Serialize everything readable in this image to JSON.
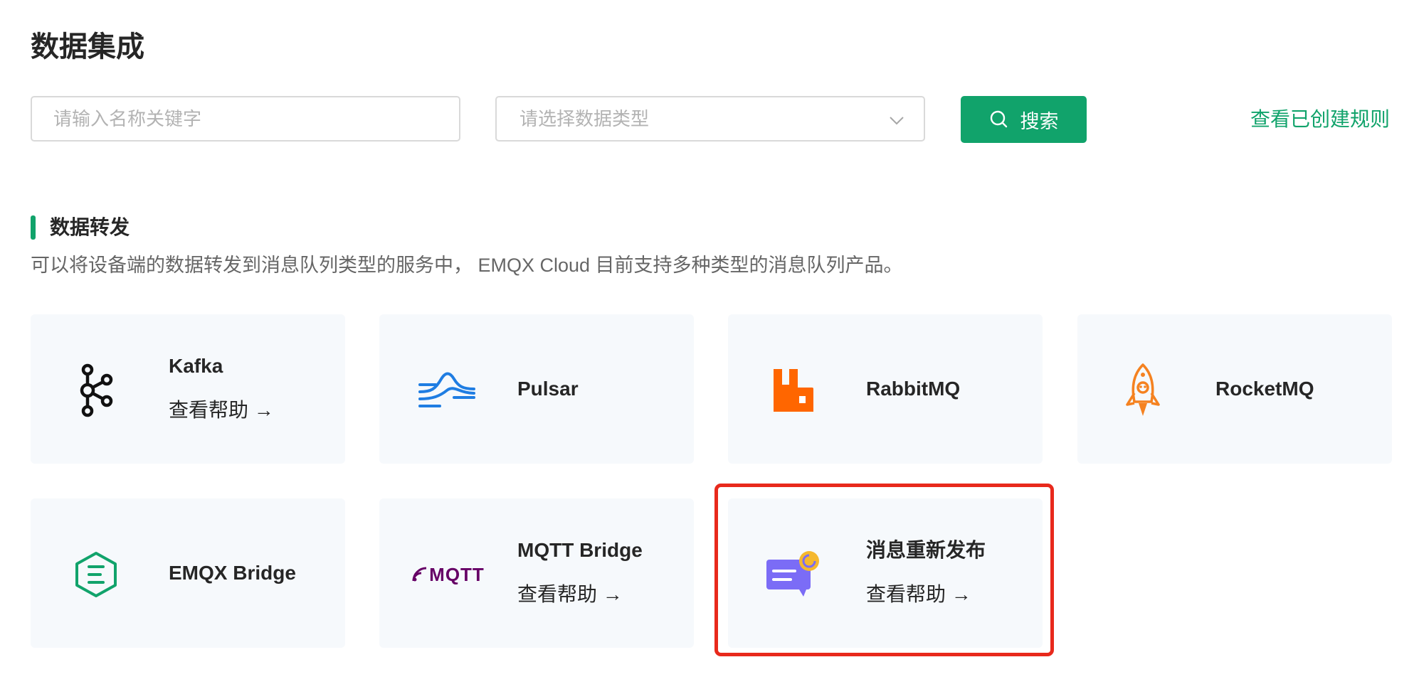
{
  "page": {
    "title": "数据集成"
  },
  "filters": {
    "search_placeholder": "请输入名称关键字",
    "type_select_placeholder": "请选择数据类型",
    "search_button_label": "搜索",
    "view_rules_link": "查看已创建规则"
  },
  "section": {
    "title": "数据转发",
    "description": "可以将设备端的数据转发到消息队列类型的服务中， EMQX Cloud 目前支持多种类型的消息队列产品。"
  },
  "cards": [
    {
      "name": "Kafka",
      "help": "查看帮助 →",
      "icon": "kafka-icon"
    },
    {
      "name": "Pulsar",
      "icon": "pulsar-icon"
    },
    {
      "name": "RabbitMQ",
      "icon": "rabbitmq-icon"
    },
    {
      "name": "RocketMQ",
      "icon": "rocketmq-icon"
    },
    {
      "name": "EMQX Bridge",
      "icon": "emqx-icon"
    },
    {
      "name": "MQTT Bridge",
      "help": "查看帮助 →",
      "icon": "mqtt-icon",
      "logo_text": "MQTT"
    },
    {
      "name": "消息重新发布",
      "help": "查看帮助 →",
      "icon": "republish-icon"
    }
  ],
  "colors": {
    "accent": "#11a36b",
    "card_bg": "#f6f9fc",
    "highlight": "#e8291c",
    "pulsar": "#1f7de2",
    "rabbitmq": "#ff6600",
    "rocketmq": "#f58220",
    "mqtt": "#660066",
    "republish": "#7b6cf6",
    "republish_badge": "#f5b82e"
  }
}
